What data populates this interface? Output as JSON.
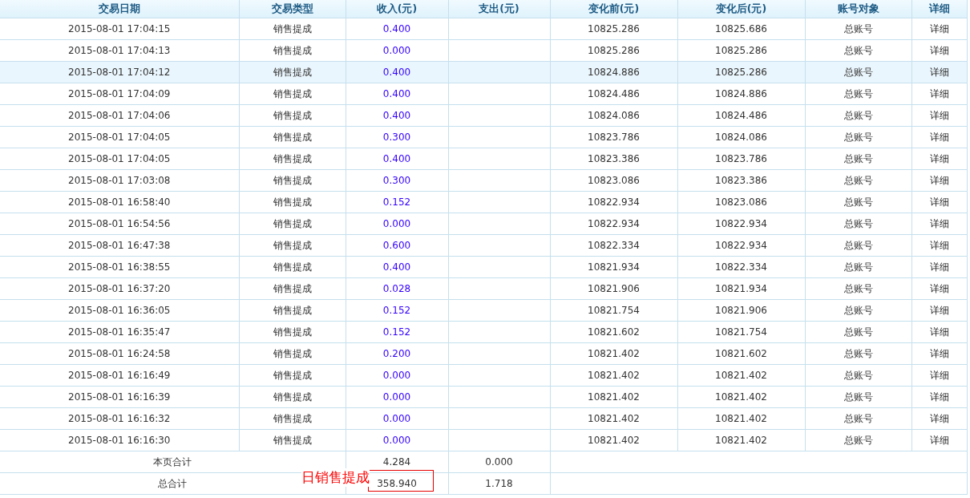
{
  "table": {
    "columns": [
      "交易日期",
      "交易类型",
      "收入(元)",
      "支出(元)",
      "变化前(元)",
      "变化后(元)",
      "账号对象",
      "详细"
    ],
    "rows": [
      {
        "date": "2015-08-01 17:04:15",
        "type": "销售提成",
        "income": "0.400",
        "before": "10825.286",
        "after": "10825.686",
        "account": "总账号",
        "detail": "详细",
        "highlighted": false
      },
      {
        "date": "2015-08-01 17:04:13",
        "type": "销售提成",
        "income": "0.000",
        "before": "10825.286",
        "after": "10825.286",
        "account": "总账号",
        "detail": "详细",
        "highlighted": false
      },
      {
        "date": "2015-08-01 17:04:12",
        "type": "销售提成",
        "income": "0.400",
        "before": "10824.886",
        "after": "10825.286",
        "account": "总账号",
        "detail": "详细",
        "highlighted": true
      },
      {
        "date": "2015-08-01 17:04:09",
        "type": "销售提成",
        "income": "0.400",
        "before": "10824.486",
        "after": "10824.886",
        "account": "总账号",
        "detail": "详细",
        "highlighted": false
      },
      {
        "date": "2015-08-01 17:04:06",
        "type": "销售提成",
        "income": "0.400",
        "before": "10824.086",
        "after": "10824.486",
        "account": "总账号",
        "detail": "详细",
        "highlighted": false
      },
      {
        "date": "2015-08-01 17:04:05",
        "type": "销售提成",
        "income": "0.300",
        "before": "10823.786",
        "after": "10824.086",
        "account": "总账号",
        "detail": "详细",
        "highlighted": false
      },
      {
        "date": "2015-08-01 17:04:05",
        "type": "销售提成",
        "income": "0.400",
        "before": "10823.386",
        "after": "10823.786",
        "account": "总账号",
        "detail": "详细",
        "highlighted": false
      },
      {
        "date": "2015-08-01 17:03:08",
        "type": "销售提成",
        "income": "0.300",
        "before": "10823.086",
        "after": "10823.386",
        "account": "总账号",
        "detail": "详细",
        "highlighted": false
      },
      {
        "date": "2015-08-01 16:58:40",
        "type": "销售提成",
        "income": "0.152",
        "before": "10822.934",
        "after": "10823.086",
        "account": "总账号",
        "detail": "详细",
        "highlighted": false
      },
      {
        "date": "2015-08-01 16:54:56",
        "type": "销售提成",
        "income": "0.000",
        "before": "10822.934",
        "after": "10822.934",
        "account": "总账号",
        "detail": "详细",
        "highlighted": false
      },
      {
        "date": "2015-08-01 16:47:38",
        "type": "销售提成",
        "income": "0.600",
        "before": "10822.334",
        "after": "10822.934",
        "account": "总账号",
        "detail": "详细",
        "highlighted": false
      },
      {
        "date": "2015-08-01 16:38:55",
        "type": "销售提成",
        "income": "0.400",
        "before": "10821.934",
        "after": "10822.334",
        "account": "总账号",
        "detail": "详细",
        "highlighted": false
      },
      {
        "date": "2015-08-01 16:37:20",
        "type": "销售提成",
        "income": "0.028",
        "before": "10821.906",
        "after": "10821.934",
        "account": "总账号",
        "detail": "详细",
        "highlighted": false
      },
      {
        "date": "2015-08-01 16:36:05",
        "type": "销售提成",
        "income": "0.152",
        "before": "10821.754",
        "after": "10821.906",
        "account": "总账号",
        "detail": "详细",
        "highlighted": false
      },
      {
        "date": "2015-08-01 16:35:47",
        "type": "销售提成",
        "income": "0.152",
        "before": "10821.602",
        "after": "10821.754",
        "account": "总账号",
        "detail": "详细",
        "highlighted": false
      },
      {
        "date": "2015-08-01 16:24:58",
        "type": "销售提成",
        "income": "0.200",
        "before": "10821.402",
        "after": "10821.602",
        "account": "总账号",
        "detail": "详细",
        "highlighted": false
      },
      {
        "date": "2015-08-01 16:16:49",
        "type": "销售提成",
        "income": "0.000",
        "before": "10821.402",
        "after": "10821.402",
        "account": "总账号",
        "detail": "详细",
        "highlighted": false
      },
      {
        "date": "2015-08-01 16:16:39",
        "type": "销售提成",
        "income": "0.000",
        "before": "10821.402",
        "after": "10821.402",
        "account": "总账号",
        "detail": "详细",
        "highlighted": false
      },
      {
        "date": "2015-08-01 16:16:32",
        "type": "销售提成",
        "income": "0.000",
        "before": "10821.402",
        "after": "10821.402",
        "account": "总账号",
        "detail": "详细",
        "highlighted": false
      },
      {
        "date": "2015-08-01 16:16:30",
        "type": "销售提成",
        "income": "0.000",
        "before": "10821.402",
        "after": "10821.402",
        "account": "总账号",
        "detail": "详细",
        "highlighted": false
      }
    ],
    "totals": [
      {
        "label": "本页合计",
        "income": "4.284",
        "expense": "0.000",
        "framed": false
      },
      {
        "label": "总合计",
        "income": "358.940",
        "expense": "1.718",
        "framed": true
      }
    ]
  },
  "annotation": {
    "text": "日销售提成"
  }
}
